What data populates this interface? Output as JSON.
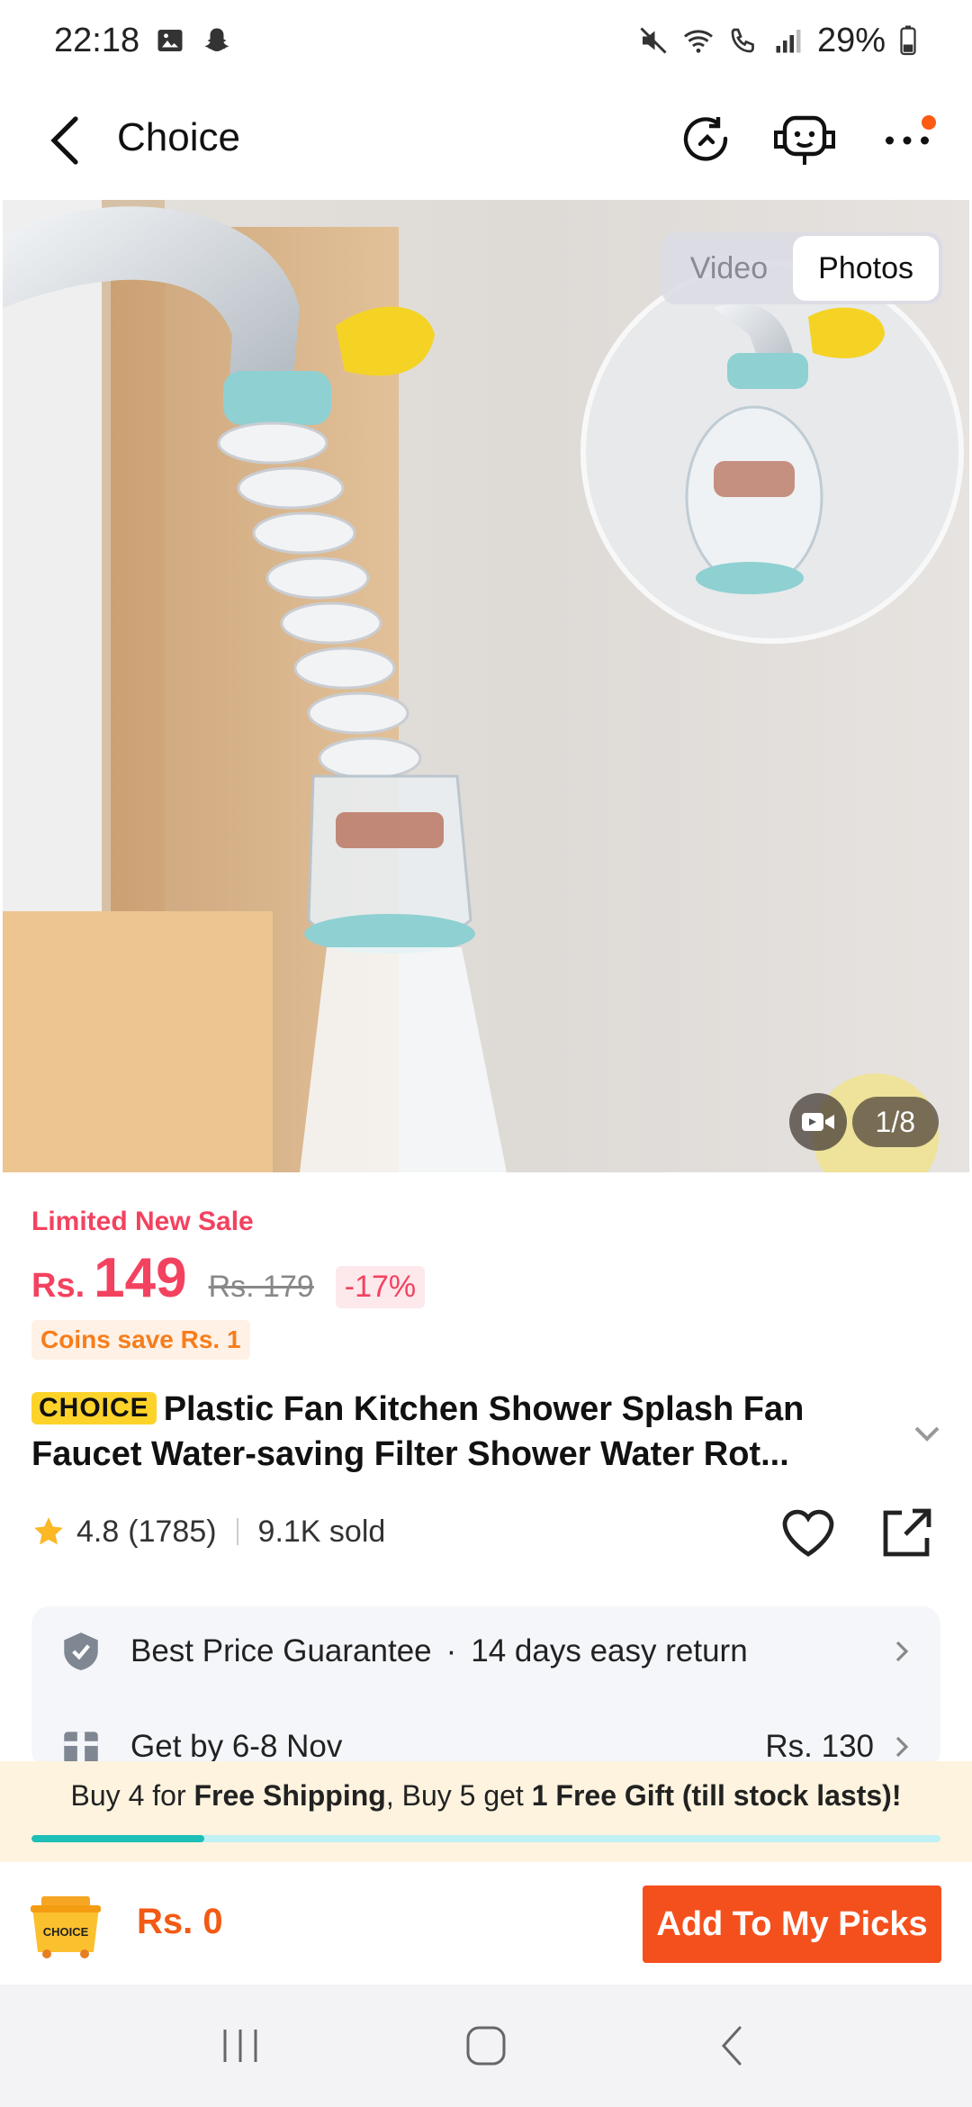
{
  "status_bar": {
    "time": "22:18",
    "battery": "29%",
    "icons": [
      "gallery-icon",
      "snapchat-icon",
      "mute-icon",
      "wifi-icon",
      "wifi-calling-icon",
      "signal-icon",
      "battery-icon"
    ]
  },
  "header": {
    "title": "Choice",
    "icons": [
      "back-icon",
      "history-icon",
      "support-robot-icon",
      "more-icon"
    ],
    "has_notification": true,
    "accent": "#fd5a13"
  },
  "gallery": {
    "toggle": {
      "video_label": "Video",
      "photos_label": "Photos",
      "active": "Photos"
    },
    "counter": "1/8"
  },
  "product": {
    "promo_label": "Limited New Sale",
    "currency": "Rs.",
    "price": "149",
    "original_price": "Rs. 179",
    "discount": "-17%",
    "coins_badge": "Coins save Rs. 1",
    "choice_logo": "CHOICE",
    "title": "Plastic Fan Kitchen Shower Splash Fan Faucet Water-saving Filter Shower Water Rot...",
    "rating": "4.8",
    "reviews": "(1785)",
    "sold": "9.1K sold",
    "price_color": "#f3425f"
  },
  "services": {
    "guarantee": "Best Price Guarantee",
    "separator": "·",
    "returns": "14 days easy return",
    "delivery": "Get by 6-8 Nov",
    "shipping_fee": "Rs. 130"
  },
  "shipping_promo": {
    "part1": "Buy 4 for ",
    "part2": "Free Shipping",
    "part3": ", Buy 5 get ",
    "part4": "1 Free Gift (till stock lasts)!",
    "progress_fraction": 0.19
  },
  "bottom_bar": {
    "cart_total": "Rs. 0",
    "cart_logo_text": "CHOICE",
    "add_button": "Add To My Picks",
    "button_color": "#f4501d"
  },
  "nav_bar": {
    "icons": [
      "recents-icon",
      "home-icon",
      "back-nav-icon"
    ]
  }
}
